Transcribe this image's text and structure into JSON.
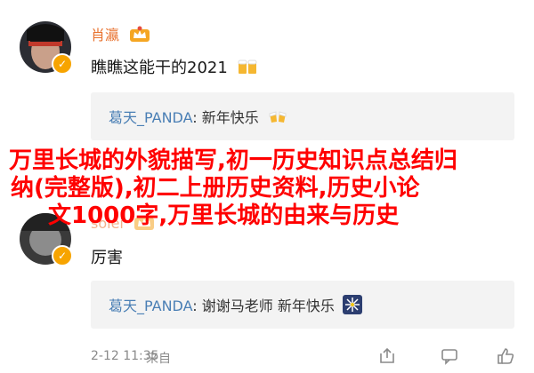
{
  "posts": [
    {
      "username": "肖瀛",
      "comment": "瞧瞧这能干的2021",
      "comment_emoji": "beer-mugs-icon",
      "reply": {
        "name": "葛天_PANDA",
        "separator": ":",
        "text": "新年快乐",
        "emoji": "cheers-icon"
      }
    },
    {
      "username": "solei",
      "comment": "厉害",
      "reply": {
        "name": "葛天_PANDA",
        "separator": ":",
        "text": "谢谢马老师 新年快乐",
        "emoji": "fireworks-icon"
      }
    }
  ],
  "meta": {
    "time": "2-12 11:35",
    "location": "来自"
  },
  "overlay_lines": [
    "万里长城的外貌描写,初一历史知识点总结归",
    "纳(完整版),初二上册历史资料,历史小论",
    "文1000字,万里长城的由来与历史"
  ],
  "colors": {
    "overlay_text": "#ff0000",
    "username": "#e8722f",
    "reply_name": "#4a7fb5",
    "badge": "#f7a400"
  }
}
